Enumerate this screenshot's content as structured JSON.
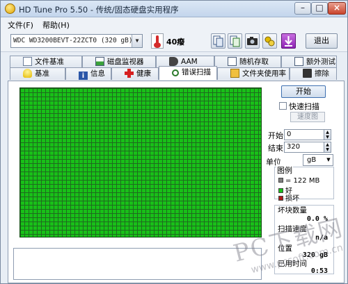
{
  "window": {
    "title": "HD Tune Pro 5.50 - 传统/固态硬盘实用程序",
    "min_label": "–",
    "max_label": "□",
    "close_label": "×"
  },
  "menu": {
    "file": "文件(F)",
    "help": "帮助(H)"
  },
  "toolbar": {
    "drive": "WDC WD3200BEVT-22ZCT0 (320 gB)",
    "temperature": "40癈",
    "exit_label": "退出",
    "icons": [
      "copy-info-icon",
      "copy-info-icon",
      "camera-icon",
      "options-icon",
      "download-icon"
    ]
  },
  "tabs": {
    "row1": [
      "文件基准",
      "磁盘监视器",
      "AAM",
      "随机存取",
      "额外测试"
    ],
    "row2": [
      "基准",
      "信息",
      "健康",
      "错误扫描",
      "文件夹使用率",
      "擦除"
    ],
    "active": "错误扫描"
  },
  "scan": {
    "start_label": "开始",
    "quick_scan_label": "快速扫描",
    "map_label": "速度图",
    "start_field_label": "开始",
    "start_value": "0",
    "end_field_label": "结束",
    "end_value": "320",
    "unit_label": "单位",
    "unit_value": "gB"
  },
  "legend": {
    "title": "图例",
    "block_size": "= 122 MB",
    "ok": "好",
    "damaged": "损坏",
    "colors": {
      "unit": "#808080",
      "ok": "#18c018",
      "damaged": "#b01818"
    }
  },
  "stats": {
    "damaged_blocks_label": "坏块数量",
    "damaged_blocks_value": "0.0 %",
    "speed_label": "扫描速度",
    "speed_value": "n/a",
    "position_label": "位置",
    "position_value": "320 gB",
    "elapsed_label": "已用时间",
    "elapsed_value": "0:53"
  },
  "watermark": {
    "text": "PC下载网",
    "url": "www.pcsoft.com.cn"
  }
}
